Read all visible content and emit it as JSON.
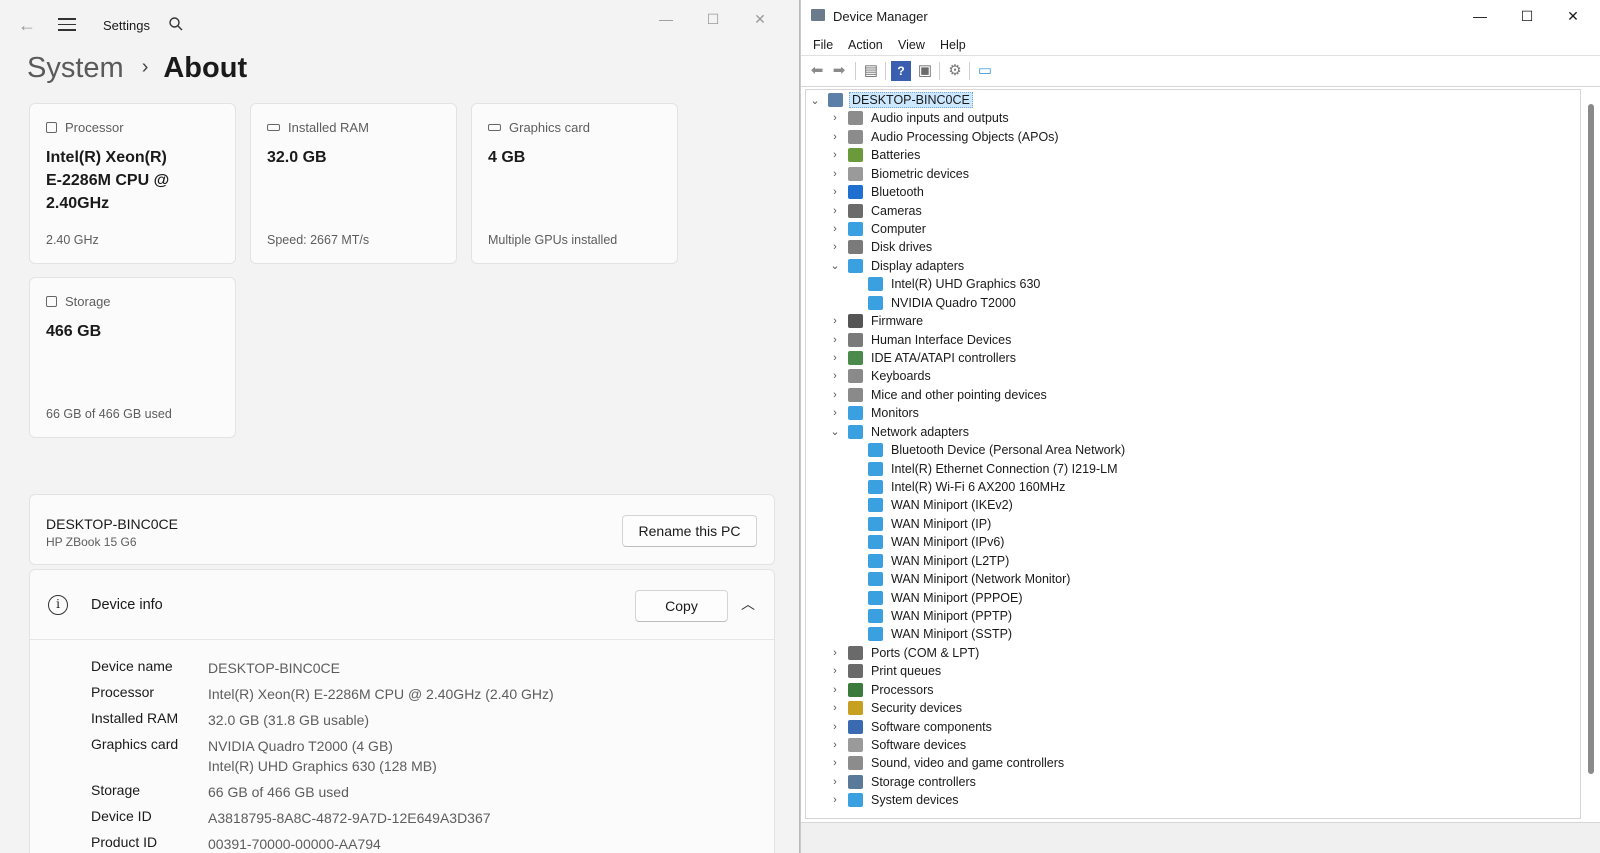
{
  "settings": {
    "app_title": "Settings",
    "breadcrumb": {
      "parent": "System",
      "separator": "›",
      "current": "About"
    },
    "cards": {
      "processor": {
        "label": "Processor",
        "value_lines": [
          "Intel(R) Xeon(R)",
          "E-2286M  CPU @",
          "2.40GHz"
        ],
        "sub": "2.40 GHz"
      },
      "ram": {
        "label": "Installed RAM",
        "value": "32.0 GB",
        "sub": "Speed: 2667 MT/s"
      },
      "graphics": {
        "label": "Graphics card",
        "value": "4 GB",
        "sub": "Multiple GPUs installed"
      },
      "storage": {
        "label": "Storage",
        "value": "466 GB",
        "sub": "66 GB of 466 GB used"
      }
    },
    "pc": {
      "name": "DESKTOP-BINC0CE",
      "model": "HP ZBook 15 G6",
      "rename_label": "Rename this PC"
    },
    "device_info": {
      "title": "Device info",
      "copy_label": "Copy",
      "rows": [
        {
          "key": "Device name",
          "value": "DESKTOP-BINC0CE"
        },
        {
          "key": "Processor",
          "value": "Intel(R) Xeon(R) E-2286M CPU @ 2.40GHz (2.40 GHz)"
        },
        {
          "key": "Installed RAM",
          "value": "32.0 GB (31.8 GB usable)"
        },
        {
          "key": "Graphics card",
          "value": "NVIDIA Quadro T2000 (4 GB)",
          "value2": "Intel(R) UHD Graphics 630 (128 MB)"
        },
        {
          "key": "Storage",
          "value": "66 GB of 466 GB used"
        },
        {
          "key": "Device ID",
          "value": "A3818795-8A8C-4872-9A7D-12E649A3D367"
        },
        {
          "key": "Product ID",
          "value": "00391-70000-00000-AA794"
        }
      ]
    }
  },
  "device_manager": {
    "title": "Device Manager",
    "menu": [
      "File",
      "Action",
      "View",
      "Help"
    ],
    "tree": [
      {
        "label": "DESKTOP-BINC0CE",
        "level": 0,
        "state": "expanded",
        "icon": "computer-root-icon",
        "color": "#5b7fa6",
        "selected": true
      },
      {
        "label": "Audio inputs and outputs",
        "level": 1,
        "state": "collapsed",
        "icon": "speaker-icon",
        "color": "#8c8c8c"
      },
      {
        "label": "Audio Processing Objects (APOs)",
        "level": 1,
        "state": "collapsed",
        "icon": "speaker-icon",
        "color": "#8c8c8c"
      },
      {
        "label": "Batteries",
        "level": 1,
        "state": "collapsed",
        "icon": "battery-icon",
        "color": "#6a9a3a"
      },
      {
        "label": "Biometric devices",
        "level": 1,
        "state": "collapsed",
        "icon": "fingerprint-icon",
        "color": "#9a9a9a"
      },
      {
        "label": "Bluetooth",
        "level": 1,
        "state": "collapsed",
        "icon": "bluetooth-icon",
        "color": "#1e6fd0"
      },
      {
        "label": "Cameras",
        "level": 1,
        "state": "collapsed",
        "icon": "camera-icon",
        "color": "#6b6b6b"
      },
      {
        "label": "Computer",
        "level": 1,
        "state": "collapsed",
        "icon": "monitor-icon",
        "color": "#3aa0e0"
      },
      {
        "label": "Disk drives",
        "level": 1,
        "state": "collapsed",
        "icon": "disk-icon",
        "color": "#7a7a7a"
      },
      {
        "label": "Display adapters",
        "level": 1,
        "state": "expanded",
        "icon": "display-adapter-icon",
        "color": "#3aa0e0"
      },
      {
        "label": "Intel(R) UHD Graphics 630",
        "level": 2,
        "state": "leaf",
        "icon": "display-adapter-icon",
        "color": "#3aa0e0"
      },
      {
        "label": "NVIDIA Quadro T2000",
        "level": 2,
        "state": "leaf",
        "icon": "display-adapter-icon",
        "color": "#3aa0e0"
      },
      {
        "label": "Firmware",
        "level": 1,
        "state": "collapsed",
        "icon": "firmware-icon",
        "color": "#555555"
      },
      {
        "label": "Human Interface Devices",
        "level": 1,
        "state": "collapsed",
        "icon": "hid-icon",
        "color": "#7a7a7a"
      },
      {
        "label": "IDE ATA/ATAPI controllers",
        "level": 1,
        "state": "collapsed",
        "icon": "controller-icon",
        "color": "#4a8a4a"
      },
      {
        "label": "Keyboards",
        "level": 1,
        "state": "collapsed",
        "icon": "keyboard-icon",
        "color": "#8a8a8a"
      },
      {
        "label": "Mice and other pointing devices",
        "level": 1,
        "state": "collapsed",
        "icon": "mouse-icon",
        "color": "#8a8a8a"
      },
      {
        "label": "Monitors",
        "level": 1,
        "state": "collapsed",
        "icon": "monitor-icon",
        "color": "#3aa0e0"
      },
      {
        "label": "Network adapters",
        "level": 1,
        "state": "expanded",
        "icon": "network-icon",
        "color": "#3aa0e0"
      },
      {
        "label": "Bluetooth Device (Personal Area Network)",
        "level": 2,
        "state": "leaf",
        "icon": "network-icon",
        "color": "#3aa0e0"
      },
      {
        "label": "Intel(R) Ethernet Connection (7) I219-LM",
        "level": 2,
        "state": "leaf",
        "icon": "network-icon",
        "color": "#3aa0e0"
      },
      {
        "label": "Intel(R) Wi-Fi 6 AX200 160MHz",
        "level": 2,
        "state": "leaf",
        "icon": "network-icon",
        "color": "#3aa0e0"
      },
      {
        "label": "WAN Miniport (IKEv2)",
        "level": 2,
        "state": "leaf",
        "icon": "network-icon",
        "color": "#3aa0e0"
      },
      {
        "label": "WAN Miniport (IP)",
        "level": 2,
        "state": "leaf",
        "icon": "network-icon",
        "color": "#3aa0e0"
      },
      {
        "label": "WAN Miniport (IPv6)",
        "level": 2,
        "state": "leaf",
        "icon": "network-icon",
        "color": "#3aa0e0"
      },
      {
        "label": "WAN Miniport (L2TP)",
        "level": 2,
        "state": "leaf",
        "icon": "network-icon",
        "color": "#3aa0e0"
      },
      {
        "label": "WAN Miniport (Network Monitor)",
        "level": 2,
        "state": "leaf",
        "icon": "network-icon",
        "color": "#3aa0e0"
      },
      {
        "label": "WAN Miniport (PPPOE)",
        "level": 2,
        "state": "leaf",
        "icon": "network-icon",
        "color": "#3aa0e0"
      },
      {
        "label": "WAN Miniport (PPTP)",
        "level": 2,
        "state": "leaf",
        "icon": "network-icon",
        "color": "#3aa0e0"
      },
      {
        "label": "WAN Miniport (SSTP)",
        "level": 2,
        "state": "leaf",
        "icon": "network-icon",
        "color": "#3aa0e0"
      },
      {
        "label": "Ports (COM & LPT)",
        "level": 1,
        "state": "collapsed",
        "icon": "port-icon",
        "color": "#6a6a6a"
      },
      {
        "label": "Print queues",
        "level": 1,
        "state": "collapsed",
        "icon": "printer-icon",
        "color": "#6a6a6a"
      },
      {
        "label": "Processors",
        "level": 1,
        "state": "collapsed",
        "icon": "processor-icon",
        "color": "#3a7a3a"
      },
      {
        "label": "Security devices",
        "level": 1,
        "state": "collapsed",
        "icon": "security-icon",
        "color": "#c8a020"
      },
      {
        "label": "Software components",
        "level": 1,
        "state": "collapsed",
        "icon": "software-component-icon",
        "color": "#3a6ab0"
      },
      {
        "label": "Software devices",
        "level": 1,
        "state": "collapsed",
        "icon": "software-device-icon",
        "color": "#9a9a9a"
      },
      {
        "label": "Sound, video and game controllers",
        "level": 1,
        "state": "collapsed",
        "icon": "sound-icon",
        "color": "#8c8c8c"
      },
      {
        "label": "Storage controllers",
        "level": 1,
        "state": "collapsed",
        "icon": "storage-controller-icon",
        "color": "#5a7a9a"
      },
      {
        "label": "System devices",
        "level": 1,
        "state": "collapsed",
        "icon": "system-device-icon",
        "color": "#3aa0e0"
      }
    ]
  }
}
